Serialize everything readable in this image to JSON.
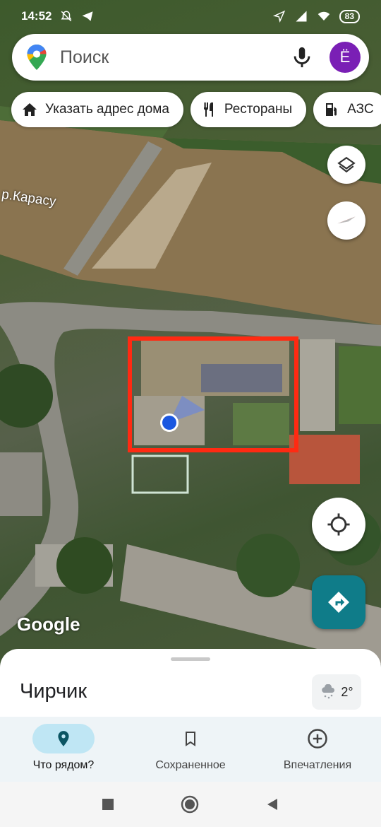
{
  "status_bar": {
    "time": "14:52",
    "battery": "83",
    "icons": [
      "do-not-disturb-icon",
      "telegram-icon",
      "location-arrow-icon",
      "signal-icon",
      "wifi-icon",
      "battery-icon"
    ]
  },
  "search": {
    "placeholder": "Поиск",
    "avatar_letter": "Ё",
    "icons": [
      "maps-pin-icon",
      "mic-icon"
    ]
  },
  "chips": [
    {
      "label": "Указать адрес дома",
      "icon": "home-icon"
    },
    {
      "label": "Рестораны",
      "icon": "restaurant-icon"
    },
    {
      "label": "АЗС",
      "icon": "gas-station-icon"
    }
  ],
  "map": {
    "river_label": "р.Карасу",
    "google_logo": "Google",
    "highlight_color": "#ff2a12"
  },
  "sheet": {
    "title": "Чирчик",
    "weather_temp": "2°",
    "weather_icon": "snow-cloud-icon"
  },
  "bottom_nav": [
    {
      "label": "Что рядом?",
      "icon": "location-pin-icon",
      "active": true
    },
    {
      "label": "Сохраненное",
      "icon": "bookmark-icon",
      "active": false
    },
    {
      "label": "Впечатления",
      "icon": "add-circle-icon",
      "active": false
    }
  ],
  "colors": {
    "accent": "#0f7c89",
    "avatar": "#7a1fb5",
    "active_nav": "#bfe6f4"
  }
}
